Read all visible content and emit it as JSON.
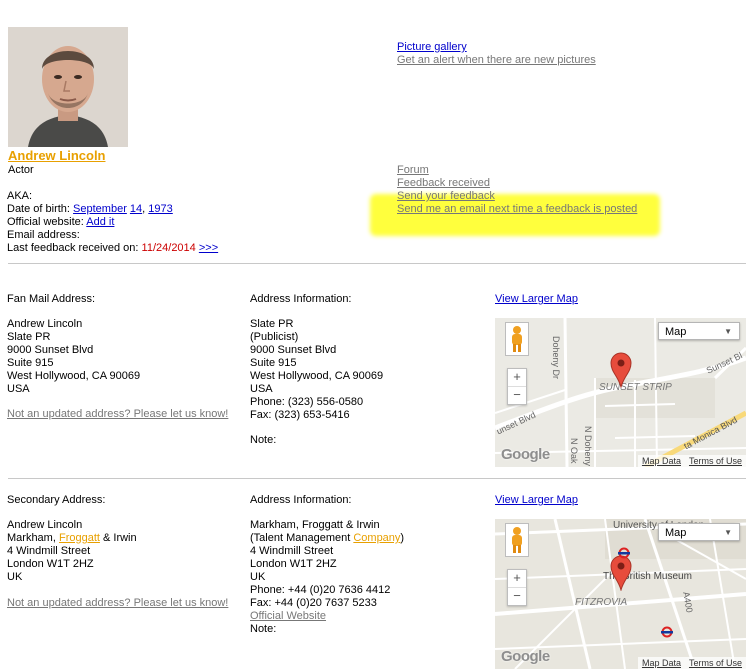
{
  "profile": {
    "name": "Andrew Lincoln",
    "role": "Actor",
    "aka_label": "AKA:",
    "dob_label": "Date of birth:",
    "dob_month": "September",
    "dob_day": "14",
    "dob_sep": ",",
    "dob_year": "1973",
    "website_label": "Official website:",
    "website_link": "Add it",
    "email_label": "Email address:",
    "last_feedback_label": "Last feedback received on:",
    "last_feedback_date": "11/24/2014",
    "last_feedback_link": ">>>"
  },
  "links": {
    "picture_gallery": "Picture gallery",
    "picture_alert": "Get an alert when there are new pictures",
    "forum": "Forum",
    "feedback_received": "Feedback received",
    "send_feedback": "Send your feedback",
    "feedback_alert": "Send me an email next time a feedback is posted"
  },
  "highlight_color": "#ffff33",
  "colors": {
    "link": "#0000cc",
    "accent": "#e8a000",
    "muted": "#777777",
    "date": "#cc0000"
  },
  "fan_mail": {
    "title": "Fan Mail Address:",
    "lines": [
      "Andrew Lincoln",
      "Slate PR",
      "9000 Sunset Blvd",
      "Suite 915",
      "West Hollywood, CA 90069",
      "USA"
    ],
    "update_link": "Not an updated address? Please let us know!"
  },
  "address1": {
    "title": "Address Information:",
    "lines": [
      "Slate PR",
      "(Publicist)",
      "9000 Sunset Blvd",
      "Suite 915",
      "West Hollywood, CA 90069",
      "USA",
      "Phone: (323) 556-0580",
      "Fax: (323) 653-5416"
    ],
    "note_label": "Note:"
  },
  "map1": {
    "larger_link": "View Larger Map",
    "map_type": "Map",
    "zoom_in": "+",
    "zoom_out": "−",
    "logo": "Google",
    "map_data": "Map Data",
    "terms": "Terms of Use",
    "labels": [
      "Doheny Dr",
      "SUNSET STRIP",
      "Sunset Bl",
      "unset Blvd",
      "N Doheny",
      "N Oak",
      "ta Monica Blvd"
    ],
    "icons": [
      "marker-icon",
      "pegman-icon"
    ]
  },
  "secondary": {
    "title": "Secondary Address:",
    "line1": "Andrew Lincoln",
    "line2_pre": "Markham, ",
    "line2_link": "Froggatt",
    "line2_post": " & Irwin",
    "line3": "4 Windmill Street",
    "line4": "London W1T 2HZ",
    "line5": "UK",
    "update_link": "Not an updated address? Please let us know!"
  },
  "address2": {
    "title": "Address Information:",
    "line1": "Markham, Froggatt & Irwin",
    "line2_pre": "(Talent Management ",
    "line2_link": "Company",
    "line2_post": ")",
    "line3": "4 Windmill Street",
    "line4": "London W1T 2HZ",
    "line5": "UK",
    "phone": "Phone: +44 (0)20 7636 4412",
    "fax": "Fax: +44 (0)20 7637 5233",
    "website": "Official Website",
    "note_label": "Note:"
  },
  "map2": {
    "larger_link": "View Larger Map",
    "map_type": "Map",
    "zoom_in": "+",
    "zoom_out": "−",
    "logo": "Google",
    "map_data": "Map Data",
    "terms": "Terms of Use",
    "labels": [
      "University of London",
      "The British Museum",
      "FITZROVIA",
      "A400"
    ],
    "icons": [
      "marker-icon",
      "pegman-icon",
      "underground-icon"
    ]
  }
}
